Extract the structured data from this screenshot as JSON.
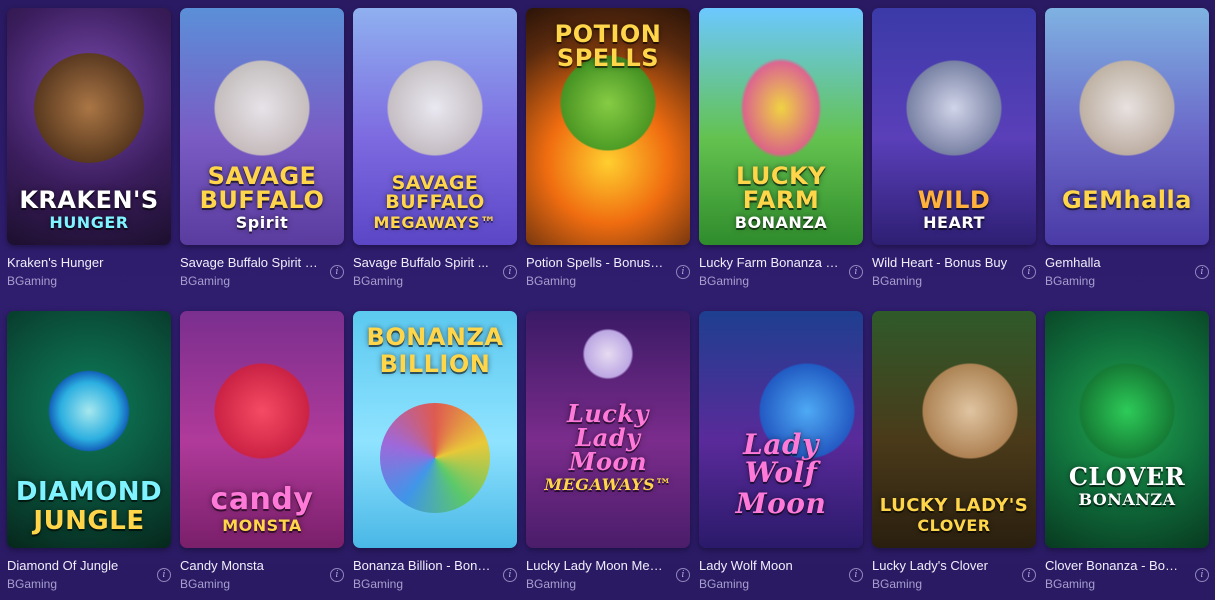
{
  "games": [
    {
      "title": "Kraken's Hunger",
      "provider": "BGaming",
      "logo": "KRAKEN'S",
      "logo_sub": "HUNGER",
      "has_info": false
    },
    {
      "title": "Savage Buffalo Spirit - ...",
      "provider": "BGaming",
      "logo": "SAVAGE BUFFALO",
      "logo_sub": "Spirit",
      "has_info": true
    },
    {
      "title": "Savage Buffalo Spirit ...",
      "provider": "BGaming",
      "logo": "SAVAGE BUFFALO",
      "logo_sub": "MEGAWAYS™",
      "has_info": true
    },
    {
      "title": "Potion Spells - Bonus B...",
      "provider": "BGaming",
      "logo": "POTION SPELLS",
      "logo_sub": "",
      "has_info": true
    },
    {
      "title": "Lucky Farm Bonanza E...",
      "provider": "BGaming",
      "logo": "LUCKY FARM",
      "logo_sub": "BONANZA",
      "has_info": true
    },
    {
      "title": "Wild Heart - Bonus Buy",
      "provider": "BGaming",
      "logo": "WILD",
      "logo_sub": "HEART",
      "has_info": true
    },
    {
      "title": "Gemhalla",
      "provider": "BGaming",
      "logo": "GEMhalla",
      "logo_sub": "",
      "has_info": true
    },
    {
      "title": "Diamond Of Jungle",
      "provider": "BGaming",
      "logo": "DIAMOND",
      "logo_sub": "JUNGLE",
      "has_info": true
    },
    {
      "title": "Candy Monsta",
      "provider": "BGaming",
      "logo": "candy",
      "logo_sub": "MONSTA",
      "has_info": true
    },
    {
      "title": "Bonanza Billion - Bonu...",
      "provider": "BGaming",
      "logo": "BONANZA",
      "logo_sub": "BILLION",
      "has_info": true
    },
    {
      "title": "Lucky Lady Moon Megaw...",
      "provider": "BGaming",
      "logo": "Lucky Lady Moon",
      "logo_sub": "MEGAWAYS™",
      "has_info": true
    },
    {
      "title": "Lady Wolf Moon",
      "provider": "BGaming",
      "logo": "Lady Wolf",
      "logo_sub": "Moon",
      "has_info": true
    },
    {
      "title": "Lucky Lady's Clover",
      "provider": "BGaming",
      "logo": "LUCKY LADY'S",
      "logo_sub": "CLOVER",
      "has_info": true
    },
    {
      "title": "Clover Bonanza - Bonu...",
      "provider": "BGaming",
      "logo": "CLOVER",
      "logo_sub": "BONANZA",
      "has_info": true
    }
  ],
  "info_icon": "i",
  "colors": {
    "background": "#2f1d6e",
    "provider_text": "#a89fcf",
    "title_text": "#f1eefc"
  }
}
